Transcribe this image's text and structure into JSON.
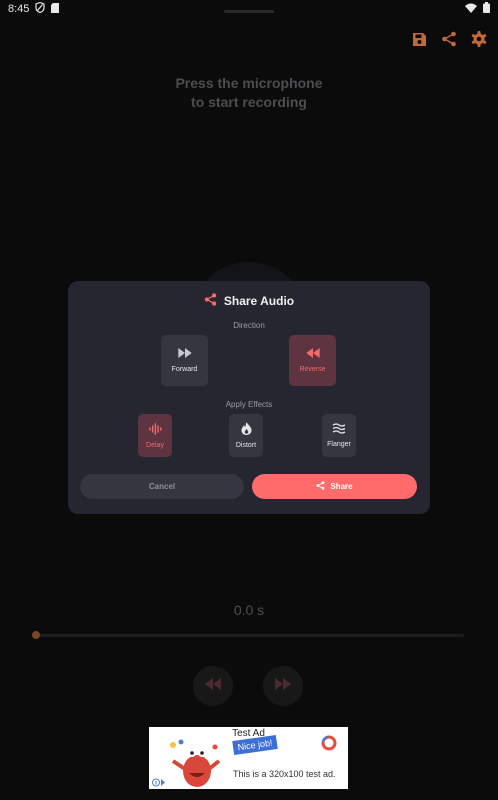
{
  "status_bar": {
    "time": "8:45"
  },
  "hint": {
    "line1": "Press the microphone",
    "line2": "to start recording"
  },
  "player": {
    "duration": "0.0 s"
  },
  "dialog": {
    "title": "Share Audio",
    "direction_label": "Direction",
    "direction_options": [
      {
        "label": "Forward",
        "selected": false
      },
      {
        "label": "Reverse",
        "selected": true
      }
    ],
    "effects_label": "Apply Effects",
    "effect_options": [
      {
        "label": "Delay",
        "selected": true
      },
      {
        "label": "Distort",
        "selected": false
      },
      {
        "label": "Flanger",
        "selected": false
      }
    ],
    "cancel_label": "Cancel",
    "share_label": "Share"
  },
  "ad": {
    "label": "Test Ad",
    "badge": "Nice job!",
    "text": "This is a 320x100 test ad."
  },
  "colors": {
    "accent": "#ff6b6b",
    "toolbar_icon": "#c2693a",
    "dialog_bg": "#262630",
    "option_bg": "#363641",
    "option_selected_bg": "#5d3440"
  }
}
